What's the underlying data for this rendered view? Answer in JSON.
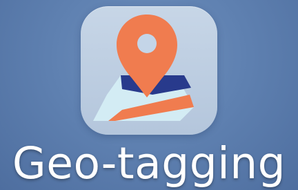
{
  "app": {
    "label": "Geo-tagging",
    "icon_name": "map-pin-icon"
  },
  "colors": {
    "wallpaper": "#5f81b1",
    "tile": "#c7d6e7",
    "pin": "#f07c4f",
    "map_navy": "#283a8c",
    "map_light": "#d3ecf4",
    "label": "#ffffff"
  }
}
